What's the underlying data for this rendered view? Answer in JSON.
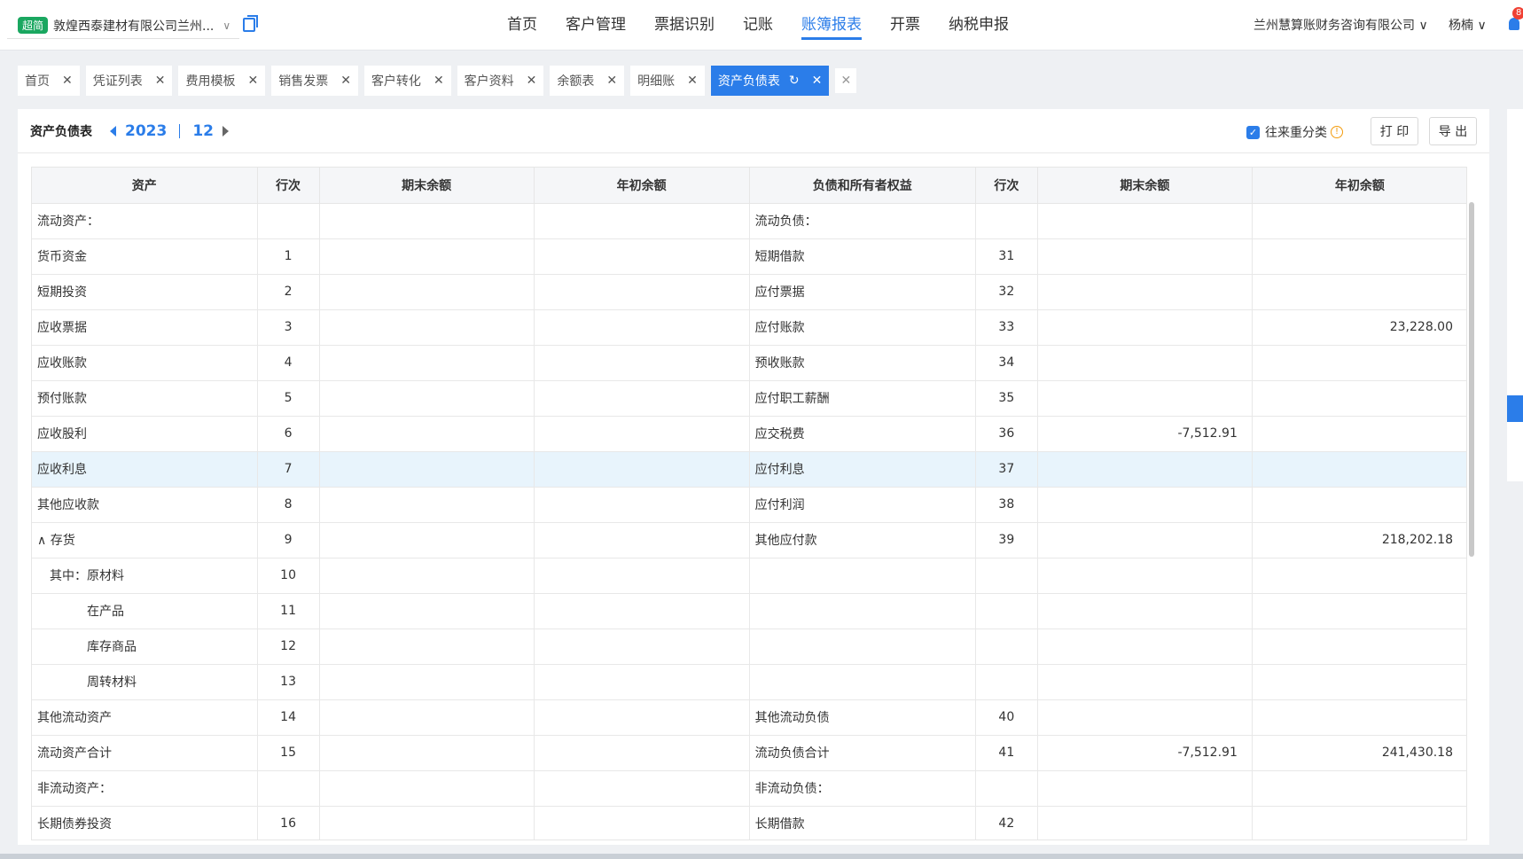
{
  "header": {
    "brand_badge": "超简",
    "company": "敦煌西泰建材有限公司兰州...",
    "nav": [
      "首页",
      "客户管理",
      "票据识别",
      "记账",
      "账簿报表",
      "开票",
      "纳税申报"
    ],
    "active_nav": "账簿报表",
    "org": "兰州慧算账财务咨询有限公司",
    "user": "杨楠",
    "bell_count": "8"
  },
  "tabs": [
    {
      "label": "首页"
    },
    {
      "label": "凭证列表"
    },
    {
      "label": "费用模板"
    },
    {
      "label": "销售发票"
    },
    {
      "label": "客户转化"
    },
    {
      "label": "客户资料"
    },
    {
      "label": "余额表"
    },
    {
      "label": "明细账"
    },
    {
      "label": "资产负债表",
      "active": true
    }
  ],
  "toolbar": {
    "title": "资产负债表",
    "year": "2023",
    "month": "12",
    "reclass_label": "往来重分类",
    "info_glyph": "!",
    "print_label": "打 印",
    "export_label": "导 出"
  },
  "table": {
    "headers": [
      "资产",
      "行次",
      "期末余额",
      "年初余额",
      "负债和所有者权益",
      "行次",
      "期末余额",
      "年初余额"
    ],
    "rows": [
      {
        "a": "流动资产：",
        "an": "",
        "ae": "",
        "ab": "",
        "l": "流动负债：",
        "ln": "",
        "le": "",
        "lb": "",
        "lvl": 0
      },
      {
        "a": "货币资金",
        "an": "1",
        "ae": "",
        "ab": "",
        "l": "短期借款",
        "ln": "31",
        "le": "",
        "lb": "",
        "lvl": 0
      },
      {
        "a": "短期投资",
        "an": "2",
        "ae": "",
        "ab": "",
        "l": "应付票据",
        "ln": "32",
        "le": "",
        "lb": "",
        "lvl": 0
      },
      {
        "a": "应收票据",
        "an": "3",
        "ae": "",
        "ab": "",
        "l": "应付账款",
        "ln": "33",
        "le": "",
        "lb": "23,228.00",
        "lvl": 0
      },
      {
        "a": "应收账款",
        "an": "4",
        "ae": "",
        "ab": "",
        "l": "预收账款",
        "ln": "34",
        "le": "",
        "lb": "",
        "lvl": 0
      },
      {
        "a": "预付账款",
        "an": "5",
        "ae": "",
        "ab": "",
        "l": "应付职工薪酬",
        "ln": "35",
        "le": "",
        "lb": "",
        "lvl": 0
      },
      {
        "a": "应收股利",
        "an": "6",
        "ae": "",
        "ab": "",
        "l": "应交税费",
        "ln": "36",
        "le": "-7,512.91",
        "lb": "",
        "lvl": 0
      },
      {
        "a": "应收利息",
        "an": "7",
        "ae": "",
        "ab": "",
        "l": "应付利息",
        "ln": "37",
        "le": "",
        "lb": "",
        "lvl": 0,
        "hl": true
      },
      {
        "a": "其他应收款",
        "an": "8",
        "ae": "",
        "ab": "",
        "l": "应付利润",
        "ln": "38",
        "le": "",
        "lb": "",
        "lvl": 0
      },
      {
        "a": "∧ 存货",
        "an": "9",
        "ae": "",
        "ab": "",
        "l": "其他应付款",
        "ln": "39",
        "le": "",
        "lb": "218,202.18",
        "lvl": 0
      },
      {
        "a": "其中：原材料",
        "an": "10",
        "ae": "",
        "ab": "",
        "l": "",
        "ln": "",
        "le": "",
        "lb": "",
        "lvl": 1
      },
      {
        "a": "在产品",
        "an": "11",
        "ae": "",
        "ab": "",
        "l": "",
        "ln": "",
        "le": "",
        "lb": "",
        "lvl": 2
      },
      {
        "a": "库存商品",
        "an": "12",
        "ae": "",
        "ab": "",
        "l": "",
        "ln": "",
        "le": "",
        "lb": "",
        "lvl": 2
      },
      {
        "a": "周转材料",
        "an": "13",
        "ae": "",
        "ab": "",
        "l": "",
        "ln": "",
        "le": "",
        "lb": "",
        "lvl": 2
      },
      {
        "a": "其他流动资产",
        "an": "14",
        "ae": "",
        "ab": "",
        "l": "其他流动负债",
        "ln": "40",
        "le": "",
        "lb": "",
        "lvl": 0
      },
      {
        "a": "流动资产合计",
        "an": "15",
        "ae": "",
        "ab": "",
        "l": "流动负债合计",
        "ln": "41",
        "le": "-7,512.91",
        "lb": "241,430.18",
        "lvl": 0
      },
      {
        "a": "非流动资产：",
        "an": "",
        "ae": "",
        "ab": "",
        "l": "非流动负债：",
        "ln": "",
        "le": "",
        "lb": "",
        "lvl": 0
      },
      {
        "a": "长期债券投资",
        "an": "16",
        "ae": "",
        "ab": "",
        "l": "长期借款",
        "ln": "42",
        "le": "",
        "lb": "",
        "lvl": 0
      }
    ]
  },
  "colors": {
    "accent": "#2b7de9",
    "highlight_row": "#e8f4fc",
    "brand": "#1aa760"
  }
}
